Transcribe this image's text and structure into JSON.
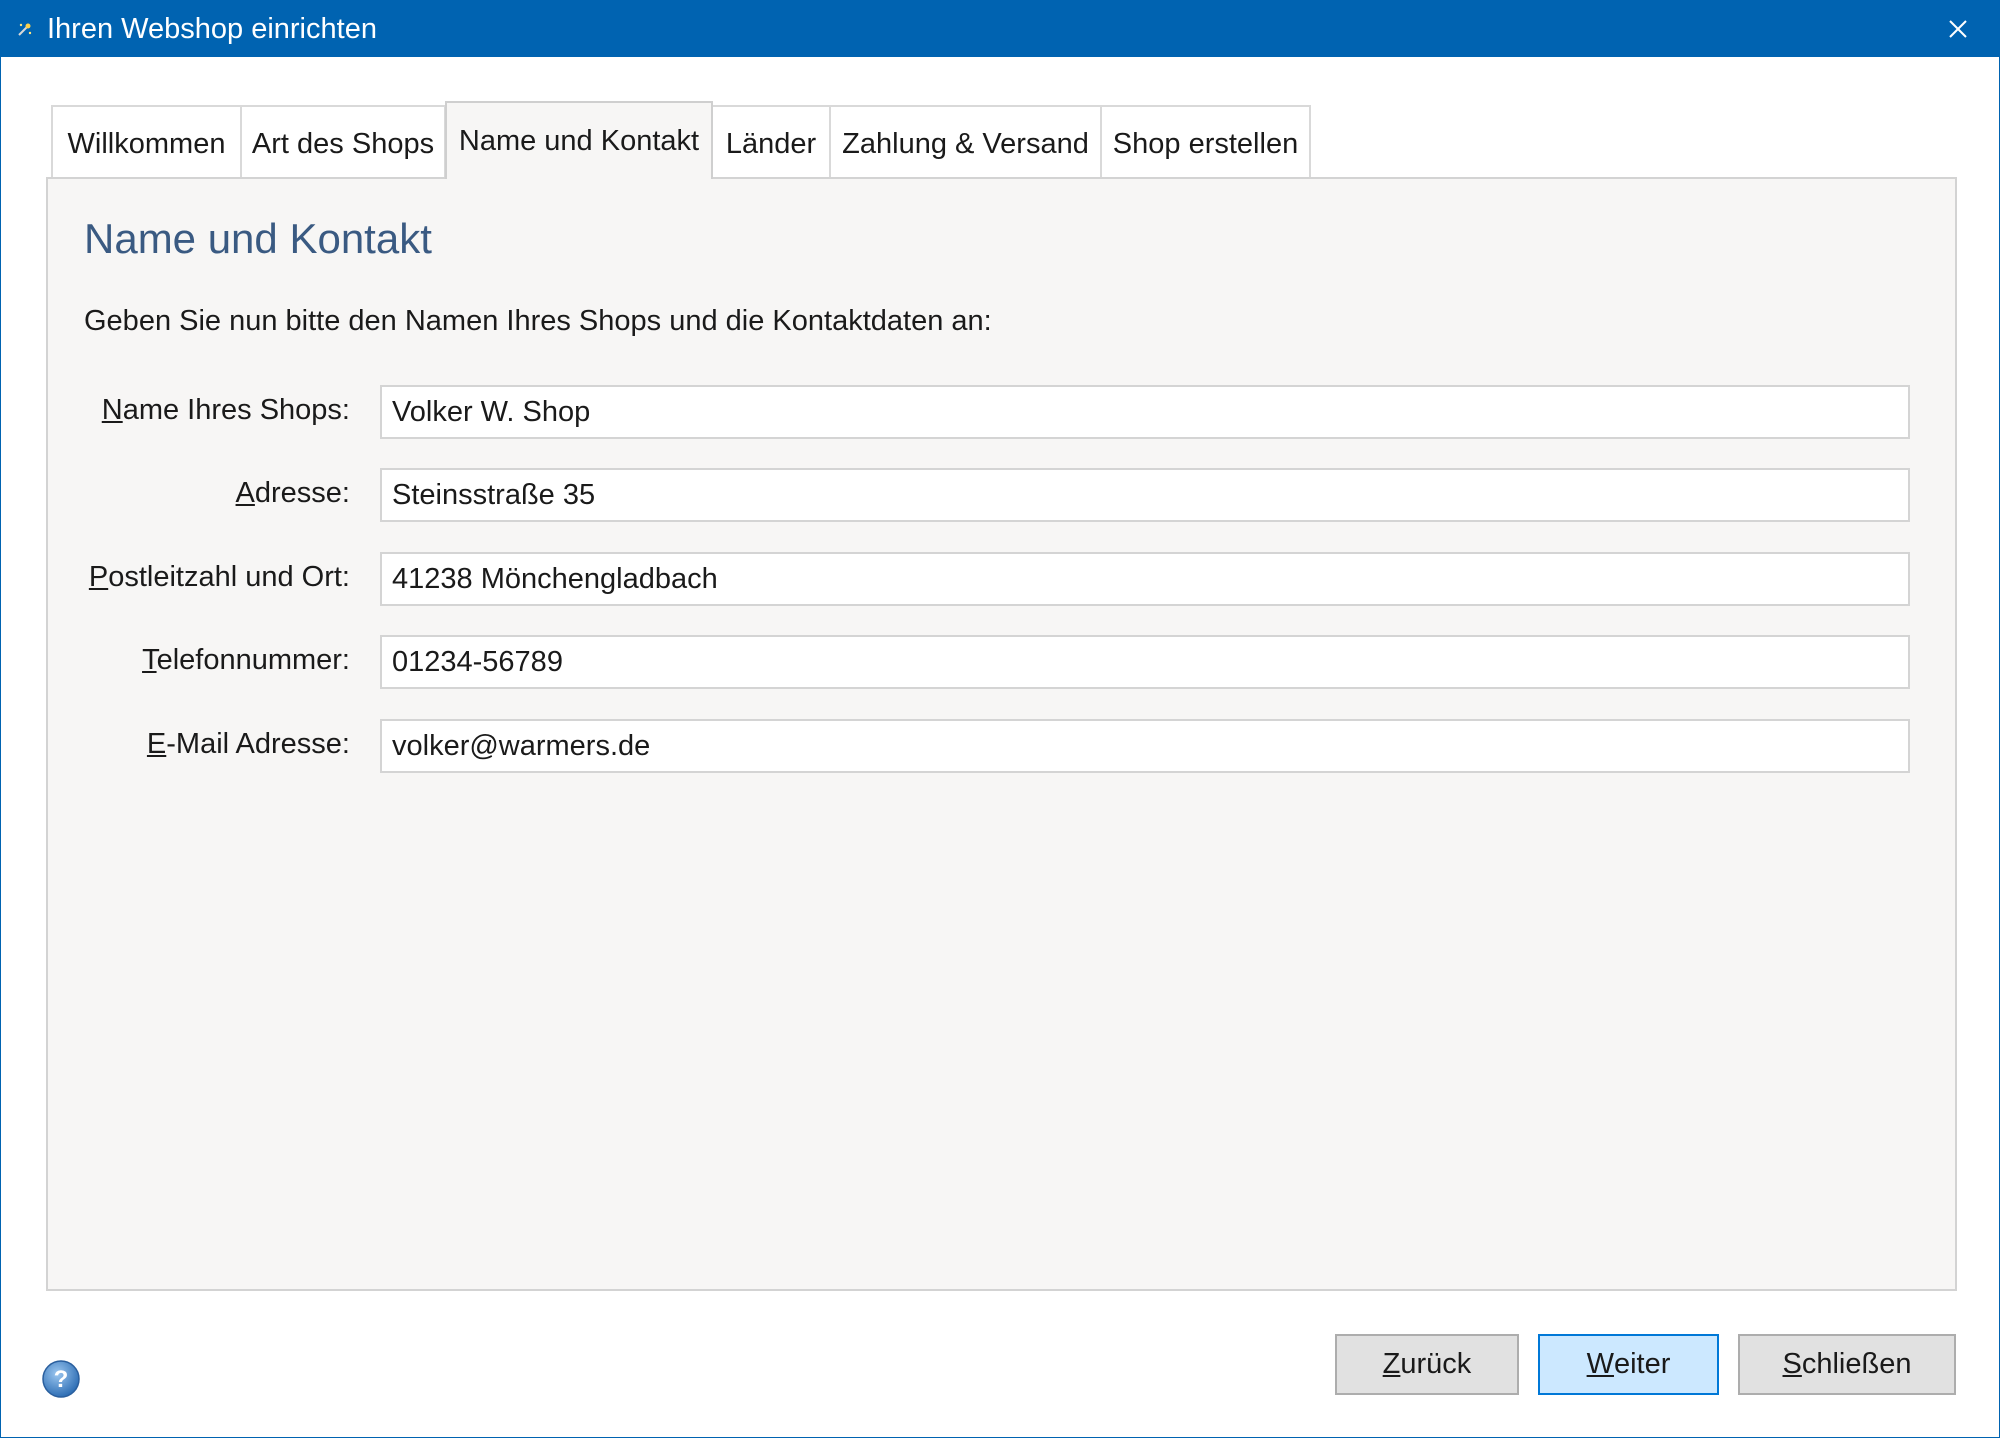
{
  "window": {
    "title": "Ihren Webshop einrichten",
    "title_icon": "wizard-wand-icon",
    "close_icon": "close-icon",
    "titlebar_color": "#0063b1"
  },
  "tabs": [
    {
      "label": "Willkommen",
      "active": false
    },
    {
      "label": "Art des Shops",
      "active": false
    },
    {
      "label": "Name und Kontakt",
      "active": true
    },
    {
      "label": "Länder",
      "active": false
    },
    {
      "label": "Zahlung & Versand",
      "active": false
    },
    {
      "label": "Shop erstellen",
      "active": false
    }
  ],
  "panel": {
    "heading": "Name und Kontakt",
    "intro": "Geben Sie nun bitte den Namen Ihres Shops und die Kontaktdaten an:",
    "heading_color": "#3a5a82"
  },
  "form": {
    "fields": [
      {
        "label_accel": "N",
        "label_rest": "ame Ihres Shops:",
        "value": "Volker W. Shop"
      },
      {
        "label_accel": "A",
        "label_rest": "dresse:",
        "value": "Steinsstraße 35"
      },
      {
        "label_accel": "P",
        "label_rest": "ostleitzahl und Ort:",
        "value": "41238 Mönchengladbach"
      },
      {
        "label_accel": "T",
        "label_rest": "elefonnummer:",
        "value": "01234-56789"
      },
      {
        "label_accel": "E",
        "label_rest": "-Mail Adresse:",
        "value": "volker@warmers.de"
      }
    ]
  },
  "footer": {
    "help_icon": "help-question-icon",
    "back": {
      "accel": "Z",
      "rest": "urück"
    },
    "next": {
      "accel": "W",
      "rest": "eiter"
    },
    "close": {
      "accel": "S",
      "rest": "chließen"
    },
    "primary_color": "#cce8ff"
  }
}
